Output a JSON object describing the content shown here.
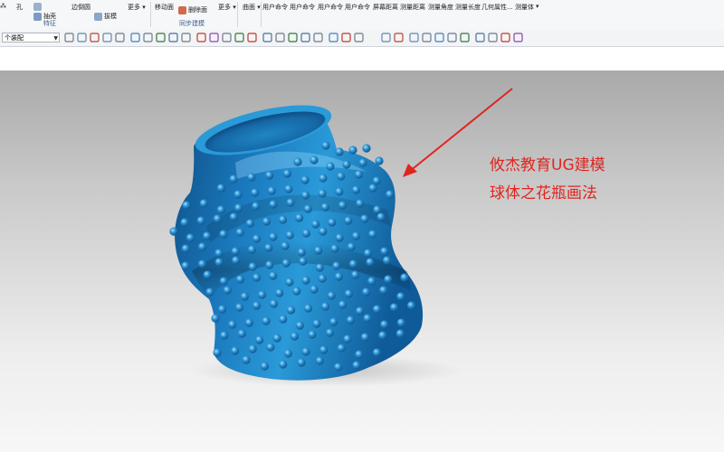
{
  "ribbon": {
    "row1": [
      "孔",
      "移动面",
      "曲面",
      "用户命令",
      "用户命令",
      "用户命令",
      "用户命令",
      "屏幕距离",
      "测量距离",
      "测量角度",
      "测量长度",
      "几何属性...",
      "测量体"
    ],
    "row2": [
      "抽壳",
      "拔模",
      "更多",
      "删除面",
      "更多"
    ],
    "partial_label": "边倒圆",
    "group_feature": "特征",
    "group_sync": "同步建模"
  },
  "commandbar": {
    "selection_filter": "个装配"
  },
  "annotation": {
    "line1": "攸杰教育UG建模",
    "line2": "球体之花瓶画法",
    "arrow_color": "#e0251f"
  },
  "model": {
    "body_color": "#1f86c4",
    "highlight_color": "#8fd3f5"
  }
}
